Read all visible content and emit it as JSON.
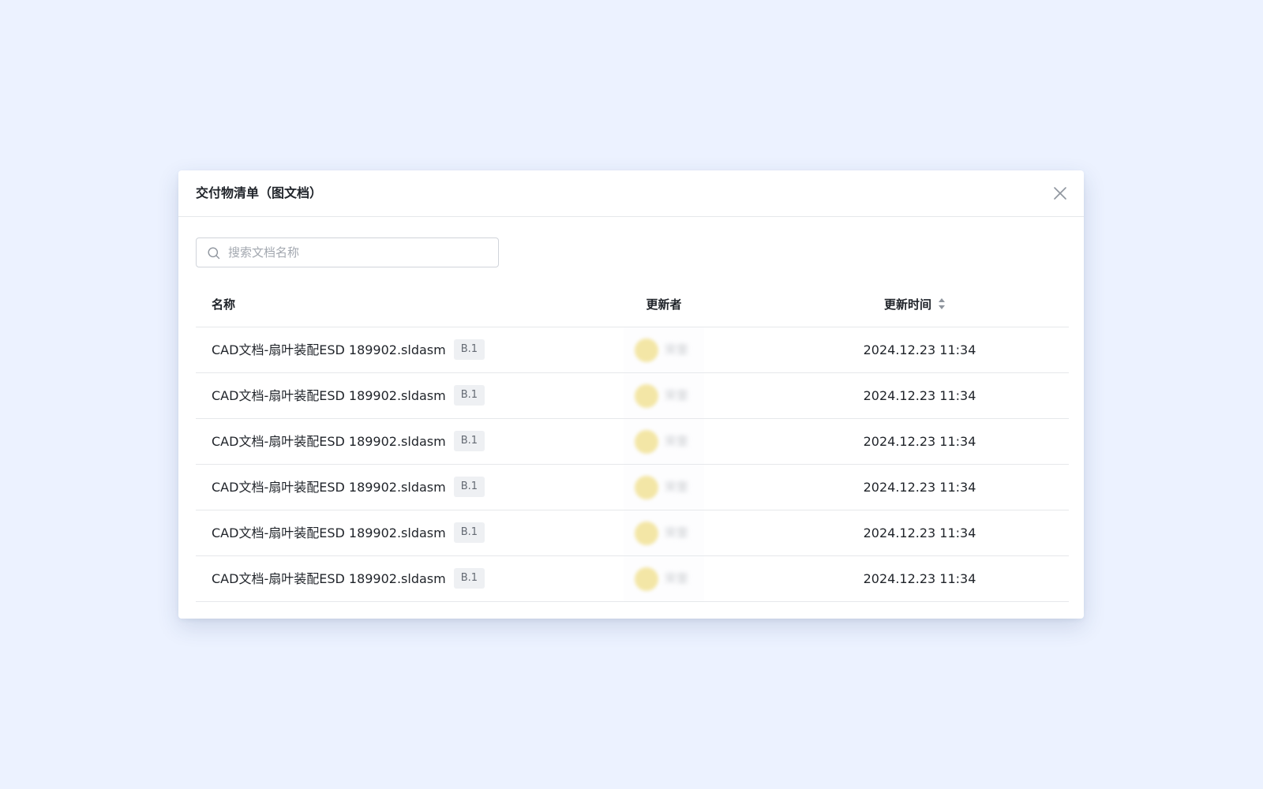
{
  "modal": {
    "title": "交付物清单（图文档）"
  },
  "search": {
    "placeholder": "搜索文档名称"
  },
  "table": {
    "columns": {
      "name": "名称",
      "updater": "更新者",
      "time": "更新时间"
    },
    "rows": [
      {
        "name": "CAD文档-扇叶装配ESD 189902.sldasm",
        "version": "B.1",
        "updater": "宋奎",
        "time": "2024.12.23 11:34"
      },
      {
        "name": "CAD文档-扇叶装配ESD 189902.sldasm",
        "version": "B.1",
        "updater": "宋奎",
        "time": "2024.12.23 11:34"
      },
      {
        "name": "CAD文档-扇叶装配ESD 189902.sldasm",
        "version": "B.1",
        "updater": "宋奎",
        "time": "2024.12.23 11:34"
      },
      {
        "name": "CAD文档-扇叶装配ESD 189902.sldasm",
        "version": "B.1",
        "updater": "宋奎",
        "time": "2024.12.23 11:34"
      },
      {
        "name": "CAD文档-扇叶装配ESD 189902.sldasm",
        "version": "B.1",
        "updater": "宋奎",
        "time": "2024.12.23 11:34"
      },
      {
        "name": "CAD文档-扇叶装配ESD 189902.sldasm",
        "version": "B.1",
        "updater": "宋奎",
        "time": "2024.12.23 11:34"
      }
    ]
  },
  "icons": {
    "close": "close-icon",
    "search": "search-icon",
    "sort": "sort-icon"
  },
  "colors": {
    "page_background": "#ecf2ff",
    "avatar": "#f3e6a6",
    "badge_background": "#eef0f3",
    "divider": "#e6e8eb"
  }
}
